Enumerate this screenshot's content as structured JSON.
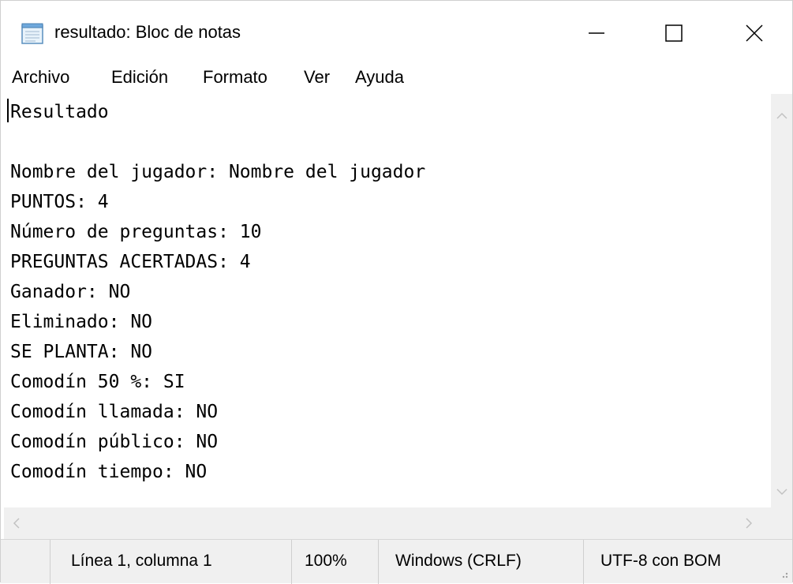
{
  "window": {
    "title": "resultado: Bloc de notas"
  },
  "menu": [
    "Archivo",
    "Edición",
    "Formato",
    "Ver",
    "Ayuda"
  ],
  "document": {
    "lines": [
      "Resultado",
      "",
      "Nombre del jugador: Nombre del jugador",
      "PUNTOS: 4",
      "Número de preguntas: 10",
      "PREGUNTAS ACERTADAS: 4",
      "Ganador: NO",
      "Eliminado: NO",
      "SE PLANTA: NO",
      "Comodín 50 %: SI",
      "Comodín llamada: NO",
      "Comodín público: NO",
      "Comodín tiempo: NO"
    ]
  },
  "status": {
    "position": "Línea 1, columna 1",
    "zoom": "100%",
    "line_ending": "Windows (CRLF)",
    "encoding": "UTF-8 con BOM"
  },
  "icons": {
    "app": "notepad-icon",
    "minimize": "minimize-icon",
    "maximize": "maximize-icon",
    "close": "close-icon"
  }
}
